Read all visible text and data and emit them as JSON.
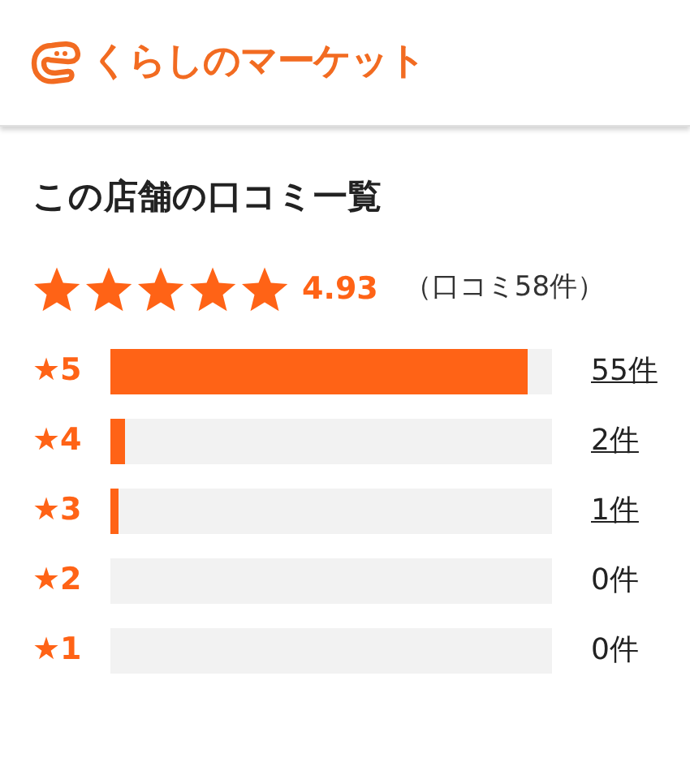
{
  "header": {
    "logo_text": "くらしのマーケット"
  },
  "title": "この店舗の口コミ一覧",
  "summary": {
    "stars": 5,
    "score": "4.93",
    "count": "（口コミ58件）"
  },
  "breakdown": [
    {
      "label": "★5",
      "level": 0.945,
      "count": "55件",
      "linked": true
    },
    {
      "label": "★4",
      "level": 0.034,
      "count": "2件",
      "linked": true
    },
    {
      "label": "★3",
      "level": 0.017,
      "count": "1件",
      "linked": true
    },
    {
      "label": "★2",
      "count": "0件",
      "linked": false
    },
    {
      "label": "★1",
      "count": "0件",
      "linked": false
    }
  ]
}
